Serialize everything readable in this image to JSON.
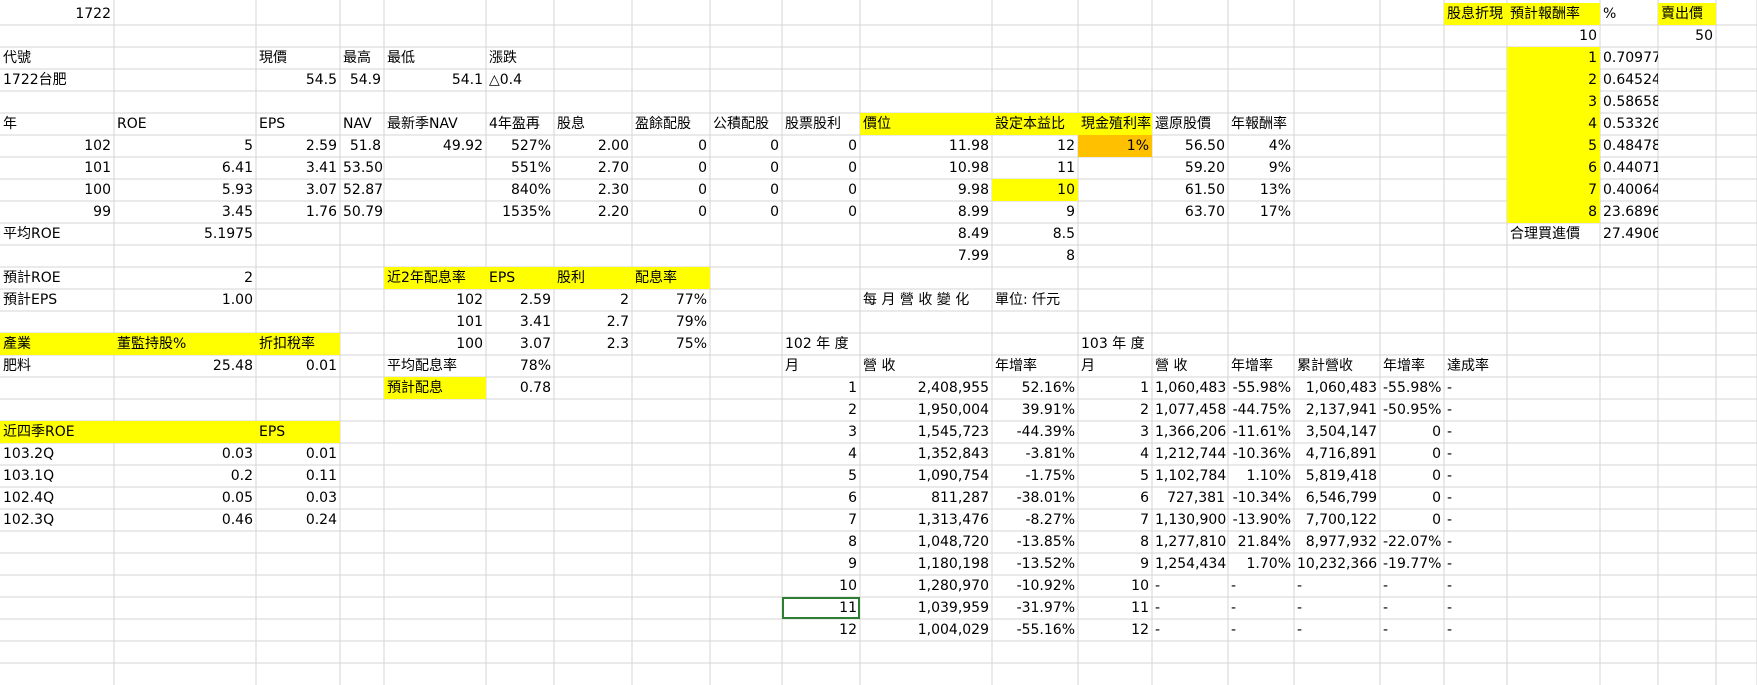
{
  "colors": {
    "highlight": "#ffff00",
    "highlight_orange": "#ffc000",
    "selection": "#2e7d32",
    "gridline": "#d4d4d4"
  },
  "top": {
    "code_value": "1722"
  },
  "stock": {
    "headers": [
      "代號",
      "現價",
      "最高",
      "最低",
      "漲跌"
    ],
    "name": "1722台肥",
    "price": "54.5",
    "high": "54.9",
    "low": "54.1",
    "change": "△0.4"
  },
  "main_table": {
    "headers": [
      "年",
      "ROE",
      "EPS",
      "NAV",
      "最新季NAV",
      "4年盈再",
      "股息",
      "盈餘配股",
      "公積配股",
      "股票股利",
      "價位",
      "設定本益比",
      "現金殖利率",
      "還原股價",
      "年報酬率"
    ],
    "rows": [
      [
        "102",
        "5",
        "2.59",
        "51.8",
        "49.92",
        "527%",
        "2.00",
        "0",
        "0",
        "0",
        "11.98",
        "12",
        "1%",
        "56.50",
        "4%"
      ],
      [
        "101",
        "6.41",
        "3.41",
        "53.50",
        "",
        "551%",
        "2.70",
        "0",
        "0",
        "0",
        "10.98",
        "11",
        "",
        "59.20",
        "9%"
      ],
      [
        "100",
        "5.93",
        "3.07",
        "52.87",
        "",
        "840%",
        "2.30",
        "0",
        "0",
        "0",
        "9.98",
        "10",
        "",
        "61.50",
        "13%"
      ],
      [
        "99",
        "3.45",
        "1.76",
        "50.79",
        "",
        "1535%",
        "2.20",
        "0",
        "0",
        "0",
        "8.99",
        "9",
        "",
        "63.70",
        "17%"
      ]
    ],
    "extra_rows": [
      [
        "8.49",
        "8.5"
      ],
      [
        "7.99",
        "8"
      ]
    ],
    "avg_roe_label": "平均ROE",
    "avg_roe_value": "5.1975"
  },
  "forecast": {
    "roe_label": "預計ROE",
    "roe_value": "2",
    "eps_label": "預計EPS",
    "eps_value": "1.00"
  },
  "industry": {
    "headers": [
      "產業",
      "董監持股%",
      "折扣稅率"
    ],
    "values": [
      "肥料",
      "25.48",
      "0.01"
    ]
  },
  "quarters": {
    "headers": [
      "近四季ROE",
      "EPS"
    ],
    "rows": [
      [
        "103.2Q",
        "0.03",
        "0.01"
      ],
      [
        "103.1Q",
        "0.2",
        "0.11"
      ],
      [
        "102.4Q",
        "0.05",
        "0.03"
      ],
      [
        "102.3Q",
        "0.46",
        "0.24"
      ]
    ]
  },
  "payout": {
    "headers": [
      "近2年配息率",
      "EPS",
      "股利",
      "配息率"
    ],
    "rows": [
      [
        "102",
        "2.59",
        "2",
        "77%"
      ],
      [
        "101",
        "3.41",
        "2.7",
        "79%"
      ],
      [
        "100",
        "3.07",
        "2.3",
        "75%"
      ]
    ],
    "avg_label": "平均配息率",
    "avg_value": "78%",
    "forecast_label": "預計配息",
    "forecast_value": "0.78"
  },
  "monthly": {
    "title": "每 月 營 收 變 化",
    "unit": "單位: 仟元",
    "year102": "102 年 度",
    "year103": "103 年 度",
    "headers102": [
      "月",
      "營 收",
      "年增率"
    ],
    "headers103": [
      "月",
      "營 收",
      "年增率",
      "累計營收",
      "年增率",
      "達成率"
    ],
    "rows": [
      [
        "1",
        "2,408,955",
        "52.16%",
        "1",
        "1,060,483",
        "-55.98%",
        "1,060,483",
        "-55.98%",
        "-"
      ],
      [
        "2",
        "1,950,004",
        "39.91%",
        "2",
        "1,077,458",
        "-44.75%",
        "2,137,941",
        "-50.95%",
        "-"
      ],
      [
        "3",
        "1,545,723",
        "-44.39%",
        "3",
        "1,366,206",
        "-11.61%",
        "3,504,147",
        "0",
        "-"
      ],
      [
        "4",
        "1,352,843",
        "-3.81%",
        "4",
        "1,212,744",
        "-10.36%",
        "4,716,891",
        "0",
        "-"
      ],
      [
        "5",
        "1,090,754",
        "-1.75%",
        "5",
        "1,102,784",
        "1.10%",
        "5,819,418",
        "0",
        "-"
      ],
      [
        "6",
        "811,287",
        "-38.01%",
        "6",
        "727,381",
        "-10.34%",
        "6,546,799",
        "0",
        "-"
      ],
      [
        "7",
        "1,313,476",
        "-8.27%",
        "7",
        "1,130,900",
        "-13.90%",
        "7,700,122",
        "0",
        "-"
      ],
      [
        "8",
        "1,048,720",
        "-13.85%",
        "8",
        "1,277,810",
        "21.84%",
        "8,977,932",
        "-22.07%",
        "-"
      ],
      [
        "9",
        "1,180,198",
        "-13.52%",
        "9",
        "1,254,434",
        "1.70%",
        "10,232,366",
        "-19.77%",
        "-"
      ],
      [
        "10",
        "1,280,970",
        "-10.92%",
        "10",
        "-",
        "-",
        "-",
        "-",
        "-"
      ],
      [
        "11",
        "1,039,959",
        "-31.97%",
        "11",
        "-",
        "-",
        "-",
        "-",
        "-"
      ],
      [
        "12",
        "1,004,029",
        "-55.16%",
        "12",
        "-",
        "-",
        "-",
        "-",
        "-"
      ]
    ]
  },
  "discount": {
    "headers": [
      "股息折現",
      "預計報酬率",
      "%",
      "賣出價"
    ],
    "rate": "10",
    "sell_price": "50",
    "rows": [
      [
        "1",
        "0.70977"
      ],
      [
        "2",
        "0.64524"
      ],
      [
        "3",
        "0.58658"
      ],
      [
        "4",
        "0.53326"
      ],
      [
        "5",
        "0.48478"
      ],
      [
        "6",
        "0.44071"
      ],
      [
        "7",
        "0.40064"
      ],
      [
        "8",
        "23.6896"
      ]
    ],
    "fair_label": "合理買進價",
    "fair_value": "27.4906"
  }
}
